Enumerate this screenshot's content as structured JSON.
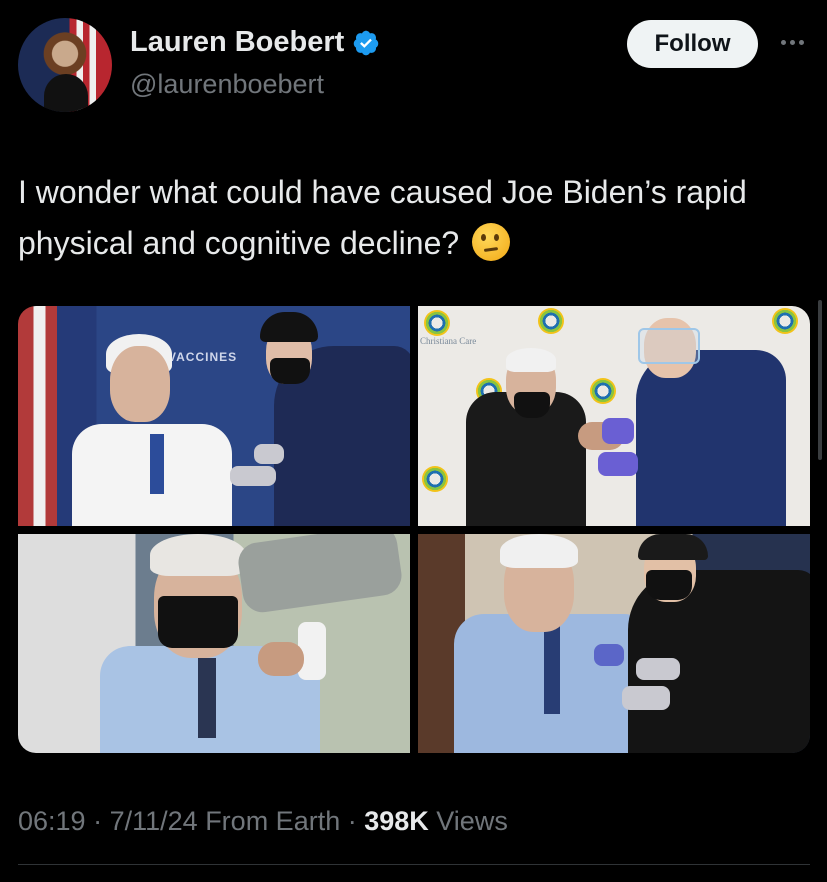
{
  "author": {
    "display_name": "Lauren Boebert",
    "handle": "@laurenboebert",
    "verified": true,
    "verified_color": "#1d9bf0"
  },
  "actions": {
    "follow_label": "Follow",
    "more_icon": "more-horizontal-icon"
  },
  "tweet": {
    "text": "I wonder what could have caused Joe Biden’s rapid physical and cognitive decline?",
    "emoji": "thinking-face"
  },
  "media": {
    "images": [
      {
        "overlay_text": "VACCINES"
      },
      {
        "overlay_text": "Christiana Care"
      },
      {
        "overlay_text": ""
      },
      {
        "overlay_text": ""
      }
    ]
  },
  "meta": {
    "time": "06:19",
    "date": "7/11/24",
    "source": "From Earth",
    "views_count": "398K",
    "views_label": "Views"
  },
  "colors": {
    "background": "#000000",
    "text": "#e7e9ea",
    "secondary_text": "#71767b",
    "follow_bg": "#eff3f4"
  }
}
